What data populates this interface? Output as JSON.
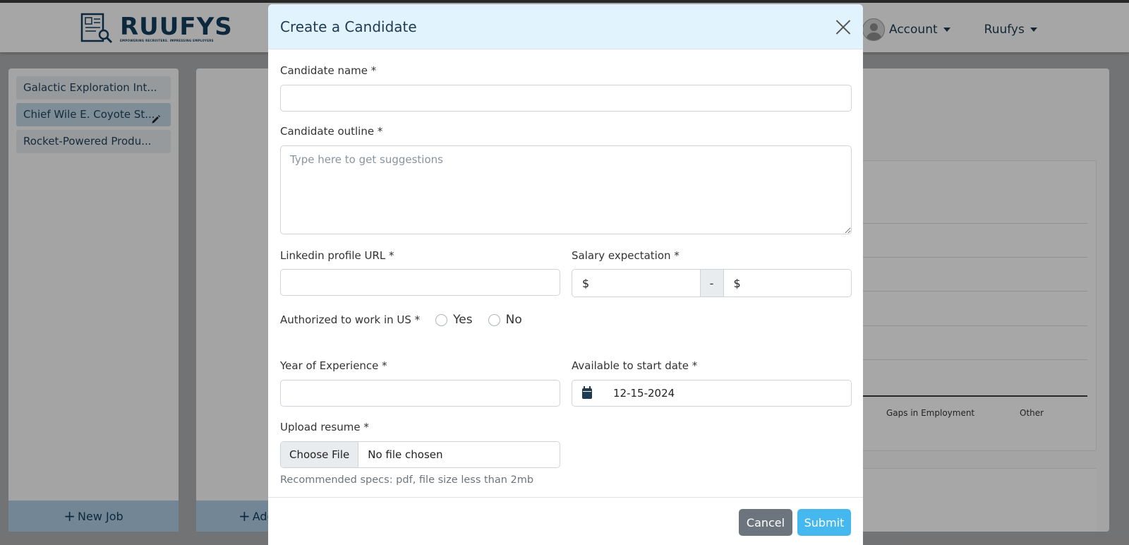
{
  "header": {
    "logo_title": "RUUFYS",
    "logo_tagline": "EMPOWERING RECRUITERS. IMPRESSING EMPLOYERS",
    "account_label": "Account",
    "org_label": "Ruufys"
  },
  "sidebar": {
    "jobs": [
      {
        "label": "Galactic Exploration Int..."
      },
      {
        "label": "Chief Wile E. Coyote St..."
      },
      {
        "label": "Rocket-Powered Produ..."
      }
    ],
    "new_job_label": "New Job"
  },
  "main": {
    "add_label": "Add",
    "chart_labels": [
      "Gaps in Employment",
      "Other"
    ]
  },
  "modal": {
    "title": "Create a Candidate",
    "name_label": "Candidate name *",
    "name_value": "",
    "outline_label": "Candidate outline *",
    "outline_placeholder": "Type here to get suggestions",
    "linkedin_label": "Linkedin profile URL *",
    "linkedin_value": "",
    "salary_label": "Salary expectation *",
    "salary_currency_min": "$",
    "salary_separator": "-",
    "salary_currency_max": "$",
    "authorized_label": "Authorized to work in US *",
    "authorized_options": [
      "Yes",
      "No"
    ],
    "experience_label": "Year of Experience *",
    "experience_value": "",
    "start_date_label": "Available to start date *",
    "start_date_value": "12-15-2024",
    "resume_label": "Upload resume *",
    "choose_file_label": "Choose File",
    "file_status": "No file chosen",
    "resume_help": "Recommended specs: pdf, file size less than 2mb",
    "cancel_label": "Cancel",
    "submit_label": "Submit"
  }
}
